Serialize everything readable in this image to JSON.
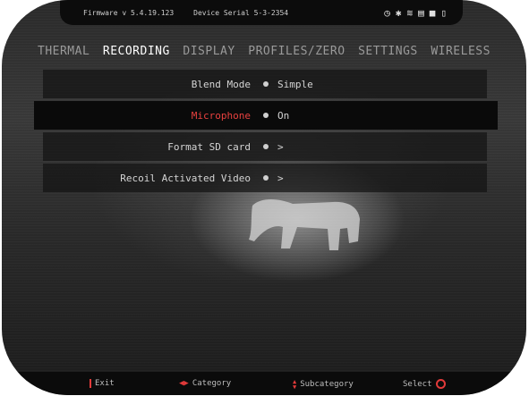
{
  "status": {
    "firmware": "Firmware v 5.4.19.123",
    "serial": "Device Serial 5-3-2354"
  },
  "tabs": [
    {
      "label": "THERMAL"
    },
    {
      "label": "RECORDING"
    },
    {
      "label": "DISPLAY"
    },
    {
      "label": "PROFILES/ZERO"
    },
    {
      "label": "SETTINGS"
    },
    {
      "label": "WIRELESS"
    }
  ],
  "menu": [
    {
      "label": "Blend Mode",
      "value": "Simple"
    },
    {
      "label": "Microphone",
      "value": "On"
    },
    {
      "label": "Format SD card",
      "value": ">"
    },
    {
      "label": "Recoil Activated Video",
      "value": ">"
    }
  ],
  "footer": {
    "exit": "Exit",
    "category": "Category",
    "subcategory": "Subcategory",
    "select": "Select"
  },
  "colors": {
    "accent": "#e8413f"
  }
}
